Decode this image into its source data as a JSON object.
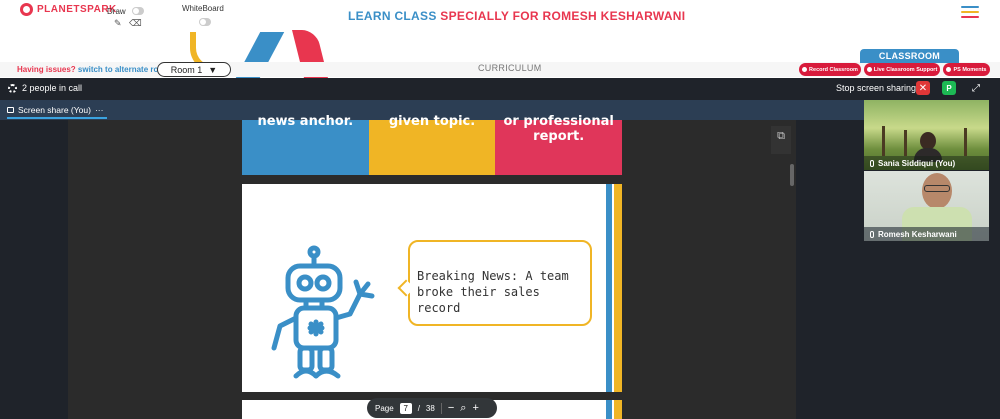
{
  "header": {
    "logo_text": "PLANETSPARK",
    "draw_label": "Draw",
    "whiteboard_label": "WhiteBoard",
    "heading_part1": "LEARN CLASS",
    "heading_part2": "SPECIALLY FOR ROMESH KESHARWANI",
    "menu_icon": "hamburger-icon"
  },
  "subbar": {
    "issues_text": "Having issues?",
    "alternate_link": "switch to alternate room",
    "room_value": "Room 1",
    "curriculum_label": "CURRICULUM",
    "classroom_tab": "CLASSROOM",
    "record_button": "Record Classroom",
    "support_button": "Live Classroom Support",
    "moments_button": "PS Moments"
  },
  "call": {
    "people_count": "2 people in call",
    "stop_sharing": "Stop screen sharing",
    "participant_initial": "P",
    "share_tab_label": "Screen share (You)"
  },
  "slides": {
    "col1": "news anchor.",
    "col2": "given topic.",
    "col3": "or professional\nreport.",
    "bubble_text": "Breaking News: A team broke their sales record"
  },
  "pager": {
    "page_label": "Page",
    "current_page": "7",
    "separator": "/",
    "total_pages": "38"
  },
  "participants": [
    {
      "name": "Sania Siddiqui (You)"
    },
    {
      "name": "Romesh Kesharwani"
    }
  ],
  "colors": {
    "brand_red": "#e8364f",
    "brand_blue": "#3a8fc7",
    "brand_yellow": "#f0b525"
  }
}
